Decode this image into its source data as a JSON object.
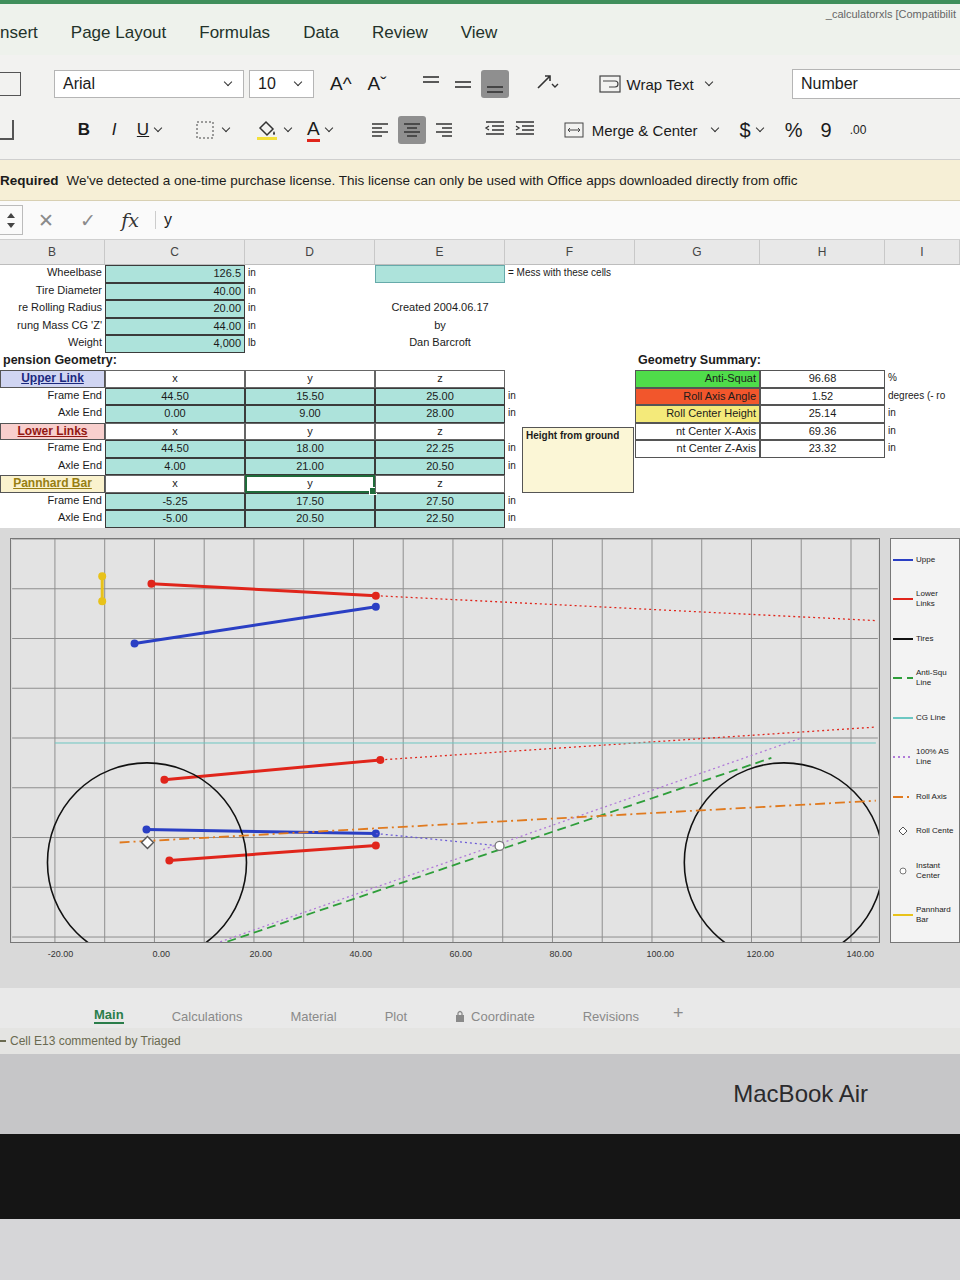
{
  "window": {
    "title": "_calculatorxls [Compatibilit"
  },
  "ribbon_tabs": [
    {
      "label": "nsert",
      "selected": false
    },
    {
      "label": "Page Layout",
      "selected": false
    },
    {
      "label": "Formulas",
      "selected": false
    },
    {
      "label": "Data",
      "selected": false
    },
    {
      "label": "Review",
      "selected": false
    },
    {
      "label": "View",
      "selected": false
    }
  ],
  "ribbon": {
    "font": "Arial",
    "size": "10",
    "grow": "A^",
    "shrink": "Aˇ",
    "bold": "B",
    "italic": "I",
    "underline": "U",
    "font_color": "A",
    "wrap_text": "Wrap Text",
    "merge": "Merge & Center",
    "number_format": "Number",
    "currency": "$",
    "percent": "%",
    "comma": "9",
    "decimals": ".00",
    "vertical_align": [
      {
        "selected": false
      },
      {
        "selected": false
      },
      {
        "selected": true
      }
    ],
    "horizontal_align": [
      {
        "selected": false
      },
      {
        "selected": true
      },
      {
        "selected": false
      }
    ]
  },
  "message_bar": {
    "title": "Required",
    "text": "We've detected a one-time purchase license. This license can only be used with Office apps downloaded directly from offic"
  },
  "formula_bar": {
    "cancel": "✕",
    "enter": "✓",
    "fx": "fx",
    "value": "y"
  },
  "columns": [
    "B",
    "C",
    "D",
    "E",
    "F",
    "G",
    "H",
    "I"
  ],
  "inputs": {
    "legend": "= Mess with these cells",
    "parameters": [
      {
        "label": "Wheelbase",
        "value": "126.5",
        "unit": "in"
      },
      {
        "label": "Tire Diameter",
        "value": "40.00",
        "unit": "in"
      },
      {
        "label": "re Rolling Radius",
        "value": "20.00",
        "unit": "in"
      },
      {
        "label": "rung Mass CG 'Z'",
        "value": "44.00",
        "unit": "in"
      },
      {
        "label": "Weight",
        "value": "4,000",
        "unit": "lb"
      }
    ]
  },
  "credits": [
    "Created 2004.06.17",
    "by",
    "Dan Barcroft"
  ],
  "geometry": {
    "title": "pension Geometry:",
    "groups": [
      {
        "name": "Upper Link",
        "color": "#2a3fc4",
        "axes": [
          {
            "label": "x",
            "selected": false
          },
          {
            "label": "y",
            "selected": false
          },
          {
            "label": "z",
            "selected": false
          }
        ],
        "rows": [
          {
            "label": "Frame End",
            "values": [
              "44.50",
              "15.50",
              "25.00"
            ],
            "unit": "in"
          },
          {
            "label": "Axle End",
            "values": [
              "0.00",
              "9.00",
              "28.00"
            ],
            "unit": "in"
          }
        ]
      },
      {
        "name": "Lower Links",
        "color": "#e0251b",
        "axes": [
          {
            "label": "x",
            "selected": false
          },
          {
            "label": "y",
            "selected": false
          },
          {
            "label": "z",
            "selected": false
          }
        ],
        "rows": [
          {
            "label": "Frame End",
            "values": [
              "44.50",
              "18.00",
              "22.25"
            ],
            "unit": "in"
          },
          {
            "label": "Axle End",
            "values": [
              "4.00",
              "21.00",
              "20.50"
            ],
            "unit": "in"
          }
        ]
      },
      {
        "name": "Pannhard Bar",
        "color": "#e8c21a",
        "axes": [
          {
            "label": "x",
            "selected": false
          },
          {
            "label": "y",
            "selected": true
          },
          {
            "label": "z",
            "selected": false
          }
        ],
        "rows": [
          {
            "label": "Frame End",
            "values": [
              "-5.25",
              "17.50",
              "27.50"
            ],
            "unit": "in"
          },
          {
            "label": "Axle End",
            "values": [
              "-5.00",
              "20.50",
              "22.50"
            ],
            "unit": "in"
          }
        ]
      }
    ]
  },
  "summary": {
    "title": "Geometry Summary:",
    "items": [
      {
        "label": "Anti-Squat",
        "value": "96.68",
        "unit": "%",
        "color": "#4fdc4a"
      },
      {
        "label": "Roll Axis Angle",
        "value": "1.52",
        "unit": "degrees (- ro",
        "color": "#f2562c"
      },
      {
        "label": "Roll Center Height",
        "value": "25.14",
        "unit": "in",
        "color": "#f4ea7a"
      },
      {
        "label": "nt Center X-Axis",
        "value": "69.36",
        "unit": "in",
        "color": "#ffffff"
      },
      {
        "label": "nt Center Z-Axis",
        "value": "23.32",
        "unit": "in",
        "color": "#ffffff"
      }
    ]
  },
  "comment": "Height from ground",
  "chart": {
    "x_ticks": [
      "-20.00",
      "0.00",
      "20.00",
      "40.00",
      "60.00",
      "80.00",
      "100.00",
      "120.00",
      "140.00"
    ],
    "series": [
      {
        "color": "#2a3fc4",
        "kind": "link",
        "points": [
          [
            -4,
            64
          ],
          [
            44.5,
            71.4
          ]
        ]
      },
      {
        "color": "#2a3fc4",
        "kind": "link",
        "points": [
          [
            -1.6,
            26.6
          ],
          [
            44.5,
            25.8
          ]
        ]
      },
      {
        "color": "#e0251b",
        "kind": "link",
        "points": [
          [
            -0.6,
            76
          ],
          [
            44.5,
            73.6
          ]
        ]
      },
      {
        "color": "#e0251b",
        "kind": "link",
        "points": [
          [
            2,
            36.6
          ],
          [
            45.4,
            40.6
          ]
        ]
      },
      {
        "color": "#e0251b",
        "kind": "link",
        "points": [
          [
            3,
            20.4
          ],
          [
            44.5,
            23.4
          ]
        ]
      },
      {
        "color": "#e0251b",
        "kind": "dotted",
        "points": [
          [
            44.5,
            73.6
          ],
          [
            145,
            68.6
          ]
        ]
      },
      {
        "color": "#e0251b",
        "kind": "dotted",
        "points": [
          [
            45.4,
            40.6
          ],
          [
            145,
            47.2
          ]
        ]
      },
      {
        "color": "#6b5bd6",
        "kind": "dotted",
        "points": [
          [
            44.5,
            25.8
          ],
          [
            69.36,
            23.32
          ]
        ]
      },
      {
        "color": "#111111",
        "kind": "tire",
        "radius": 20,
        "points": [
          [
            -1.5,
            20
          ],
          [
            126.5,
            20
          ]
        ]
      },
      {
        "color": "#2e9e3a",
        "kind": "dashed",
        "points": [
          [
            1.4,
            -0.4
          ],
          [
            124,
            41
          ]
        ]
      },
      {
        "color": "#b07ad8",
        "kind": "dotted",
        "points": [
          [
            0,
            -0.6
          ],
          [
            130,
            45
          ]
        ]
      },
      {
        "color": "#6cc7c2",
        "kind": "line",
        "points": [
          [
            -20,
            44
          ],
          [
            145,
            44
          ]
        ]
      },
      {
        "color": "#e07a1f",
        "kind": "dashdot",
        "points": [
          [
            -7,
            24
          ],
          [
            145,
            32.4
          ]
        ]
      },
      {
        "color": "#555555",
        "kind": "diamond",
        "points": [
          [
            -1.4,
            24
          ]
        ]
      },
      {
        "color": "#777777",
        "kind": "ring",
        "points": [
          [
            69.36,
            23.32
          ]
        ]
      },
      {
        "color": "#e8c21a",
        "kind": "link",
        "points": [
          [
            -10.5,
            77.5
          ],
          [
            -10.5,
            72.5
          ]
        ]
      }
    ],
    "legend": [
      {
        "label": "Uppe",
        "color": "#2a3fc4",
        "kind": "line"
      },
      {
        "label": "Lower Links",
        "color": "#e0251b",
        "kind": "line"
      },
      {
        "label": "Tires",
        "color": "#111111",
        "kind": "line"
      },
      {
        "label": "Anti-Squ Line",
        "color": "#2e9e3a",
        "kind": "dashed"
      },
      {
        "label": "CG Line",
        "color": "#6cc7c2",
        "kind": "line"
      },
      {
        "label": "100% AS Line",
        "color": "#b07ad8",
        "kind": "dotted"
      },
      {
        "label": "Roll Axis",
        "color": "#e07a1f",
        "kind": "dashdot"
      },
      {
        "label": "Roll Cente",
        "color": "#555555",
        "kind": "diamond"
      },
      {
        "label": "Instant Center",
        "color": "#777777",
        "kind": "ring"
      },
      {
        "label": "Pannhard Bar",
        "color": "#e8c21a",
        "kind": "line"
      }
    ]
  },
  "sheet_tabs": [
    {
      "label": "Main",
      "selected": true,
      "locked": false
    },
    {
      "label": "Calculations",
      "selected": false,
      "locked": false
    },
    {
      "label": "Material",
      "selected": false,
      "locked": false
    },
    {
      "label": "Plot",
      "selected": false,
      "locked": false
    },
    {
      "label": "Coordinate",
      "selected": false,
      "locked": true
    },
    {
      "label": "Revisions",
      "selected": false,
      "locked": false
    }
  ],
  "add_sheet": "+",
  "status": "Cell E13 commented by Triaged",
  "device": {
    "label": "MacBook Air"
  }
}
